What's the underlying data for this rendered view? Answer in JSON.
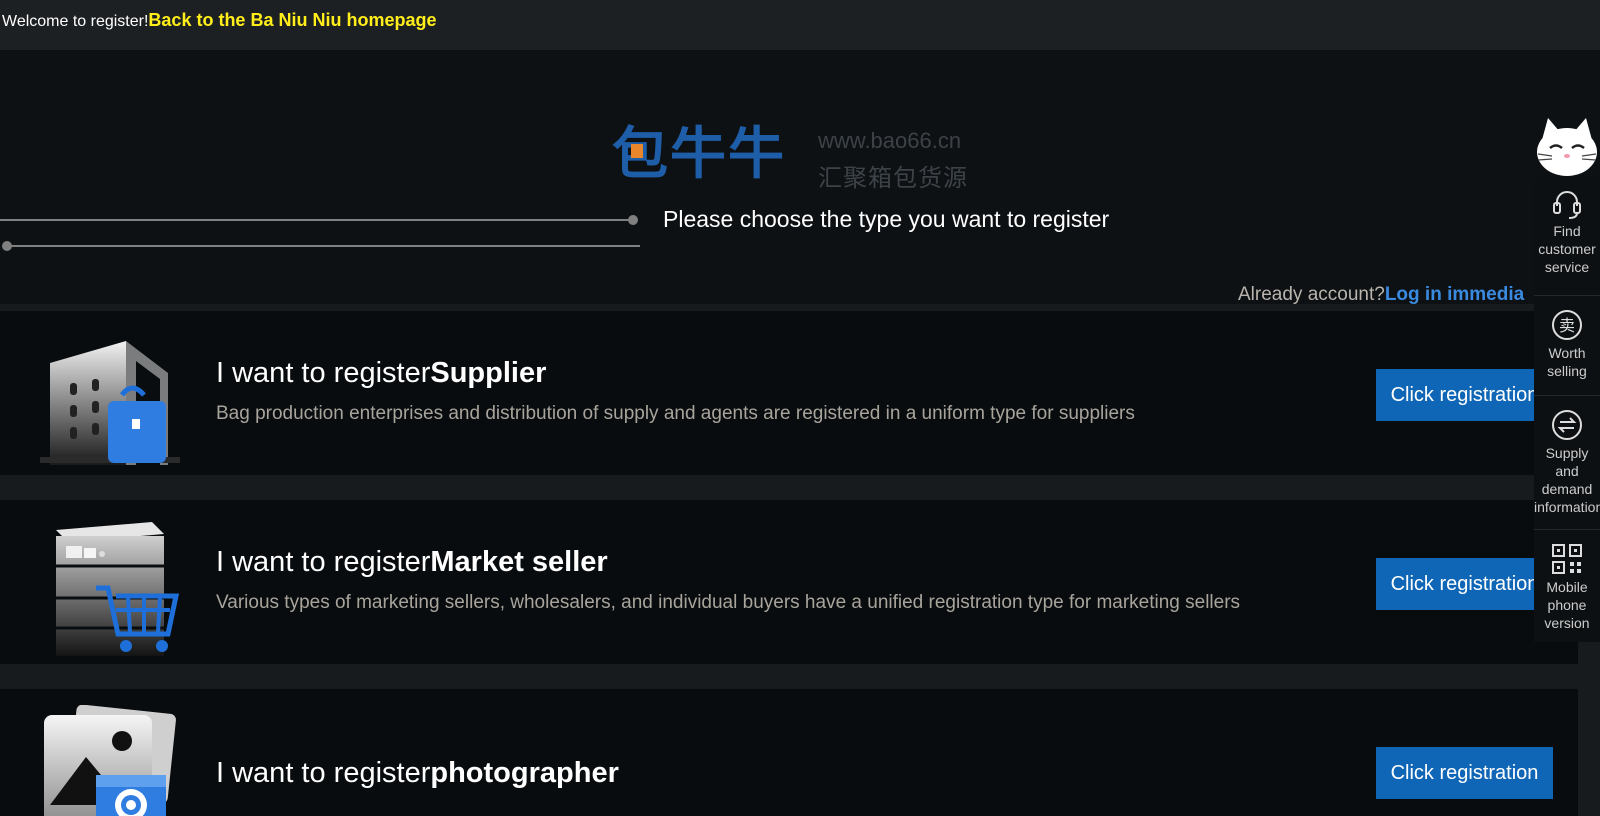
{
  "topbar": {
    "welcome_text": "Welcome to register!",
    "home_link": "Back to the Ba Niu Niu homepage"
  },
  "logo": {
    "brand_cn": "包牛牛",
    "url": "www.bao66.cn",
    "slogan": "汇聚箱包货源"
  },
  "header": {
    "choose_text": "Please choose the type you want to register",
    "already_text": "Already account?",
    "login_link": "Log in immedia"
  },
  "cards": [
    {
      "title_prefix": "I want to register",
      "title_type": "Supplier",
      "description": "Bag production enterprises and distribution of supply and agents are registered in a uniform type for suppliers",
      "button": "Click registration",
      "icon": "building-bag-icon"
    },
    {
      "title_prefix": "I want to register",
      "title_type": "Market seller",
      "description": "Various types of marketing sellers, wholesalers, and individual buyers have a unified registration type for marketing sellers",
      "button": "Click registration",
      "icon": "boxes-cart-icon"
    },
    {
      "title_prefix": "I want to register",
      "title_type": "photographer",
      "description": "",
      "button": "Click registration",
      "icon": "photo-camera-icon"
    }
  ],
  "sidebar": {
    "items": [
      {
        "label": "Find customer service",
        "icon": "headset-icon"
      },
      {
        "label": "Worth selling",
        "icon": "sell-icon"
      },
      {
        "label": "Supply and demand information",
        "icon": "exchange-icon"
      },
      {
        "label": "Mobile phone version",
        "icon": "qr-code-icon"
      }
    ]
  },
  "colors": {
    "accent_yellow": "#ffee1a",
    "button_blue": "#0f66b6",
    "link_blue": "#3a8ae0",
    "logo_blue": "#1e5ea8"
  }
}
